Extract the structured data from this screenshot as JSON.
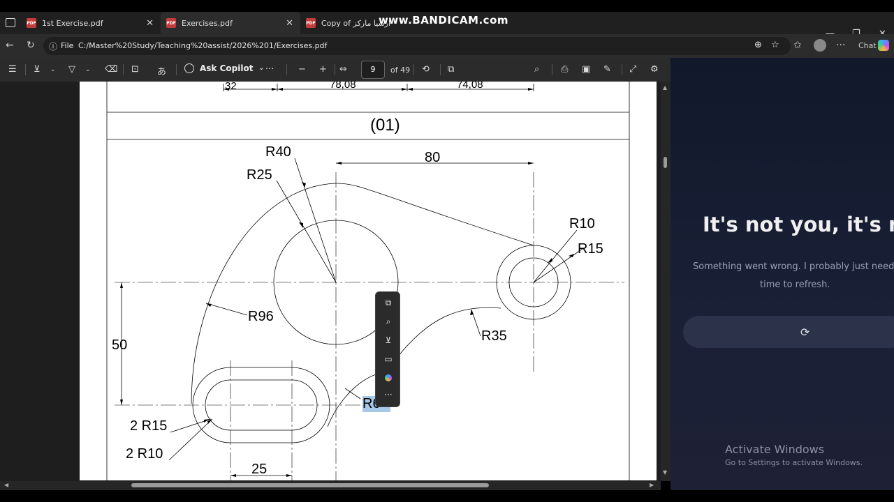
{
  "browser": {
    "tabs": [
      {
        "label": "1st Exercise.pdf"
      },
      {
        "label": "Exercises.pdf"
      },
      {
        "label": "Copy of ارسيا ماركز"
      }
    ],
    "watermark": "www.BANDICAM.com",
    "address": {
      "scheme": "File",
      "path": "C:/Master%20Study/Teaching%20assist/2026%201/Exercises.pdf"
    },
    "chat_button": "Chat"
  },
  "pdf_toolbar": {
    "ask_copilot": "Ask Copilot",
    "more": "···",
    "zoom_out": "−",
    "zoom_in": "+",
    "page_current": "9",
    "page_total": "of 49",
    "read_aloud": "あ"
  },
  "drawing": {
    "top_dims": [
      "32",
      "78,08",
      "74,08"
    ],
    "section_label": "(01)",
    "labels": {
      "r40": "R40",
      "r25": "R25",
      "d80": "80",
      "r10": "R10",
      "r15": "R15",
      "r96": "R96",
      "d50": "50",
      "r35": "R35",
      "r_hidden": "R6",
      "r15x2": "2 R15",
      "r10x2": "2 R10",
      "d25": "25"
    }
  },
  "floating_toolbar": {
    "items": [
      "copy-icon",
      "search-icon",
      "highlight-icon",
      "comment-icon",
      "copilot-icon",
      "more-icon"
    ],
    "more": "···"
  },
  "chat_panel": {
    "title": "It's not you, it's me",
    "message_line1": "Something went wrong. I probably just need",
    "message_line2": "time to refresh.",
    "retry_icon": "⟳"
  },
  "watermark_os": {
    "line1": "Activate Windows",
    "line2": "Go to Settings to activate Windows."
  },
  "colors": {
    "page": "#ffffff",
    "dark_bg": "#1e1e1e",
    "chat_bg": "#151b2e",
    "selection": "#a8c8e8"
  }
}
